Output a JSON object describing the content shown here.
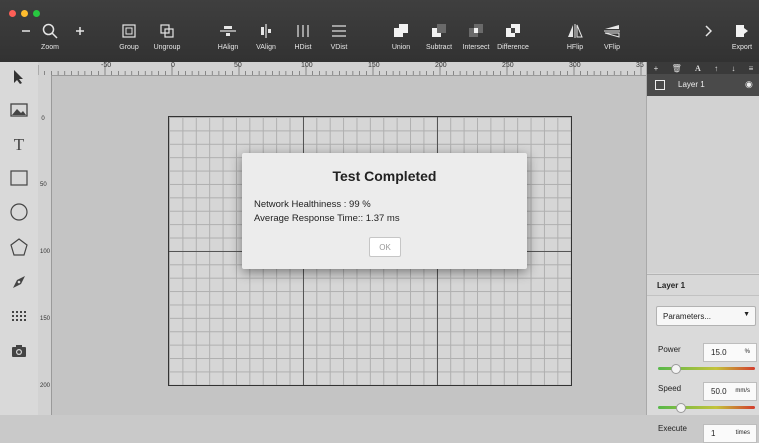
{
  "window": {
    "traffic_lights": [
      "#ff5f57",
      "#febc2e",
      "#28c840"
    ]
  },
  "toolbar": {
    "zoom_out_icon": "minus-icon",
    "zoom_label": "Zoom",
    "zoom_in_icon": "plus-icon",
    "group_label": "Group",
    "ungroup_label": "Ungroup",
    "halign_label": "HAlign",
    "valign_label": "VAlign",
    "hdist_label": "HDist",
    "vdist_label": "VDist",
    "union_label": "Union",
    "subtract_label": "Subtract",
    "intersect_label": "Intersect",
    "difference_label": "Difference",
    "hflip_label": "HFlip",
    "vflip_label": "VFlip",
    "export_label": "Export",
    "more_icon": "chevron-right-icon"
  },
  "left_tools": [
    "cursor-icon",
    "image-icon",
    "text-icon",
    "rectangle-icon",
    "ellipse-icon",
    "polygon-icon",
    "pen-icon",
    "grid-icon",
    "camera-icon"
  ],
  "ruler": {
    "top_labels": [
      "-50",
      "0",
      "50",
      "100",
      "150",
      "200",
      "250",
      "300",
      "35"
    ],
    "left_labels": [
      "0",
      "50",
      "100",
      "150",
      "200"
    ]
  },
  "layers_panel": {
    "header_icons": [
      "add-icon",
      "trash-icon",
      "text-icon",
      "move-up-icon",
      "move-down-icon",
      "menu-icon"
    ],
    "layer_name": "Layer 1"
  },
  "properties": {
    "section_title": "Layer 1",
    "mode_select": "Parameters...",
    "power_label": "Power",
    "power_value": "15.0",
    "power_unit": "%",
    "power_level": 0.15,
    "speed_label": "Speed",
    "speed_value": "50.0",
    "speed_unit": "mm/s",
    "speed_level": 0.2,
    "execute_label": "Execute",
    "execute_value": "1",
    "execute_unit": "times"
  },
  "dialog": {
    "title": "Test Completed",
    "line1": "Network Healthiness : 99 %",
    "line2": "Average Response Time:: 1.37 ms",
    "ok_label": "OK"
  }
}
